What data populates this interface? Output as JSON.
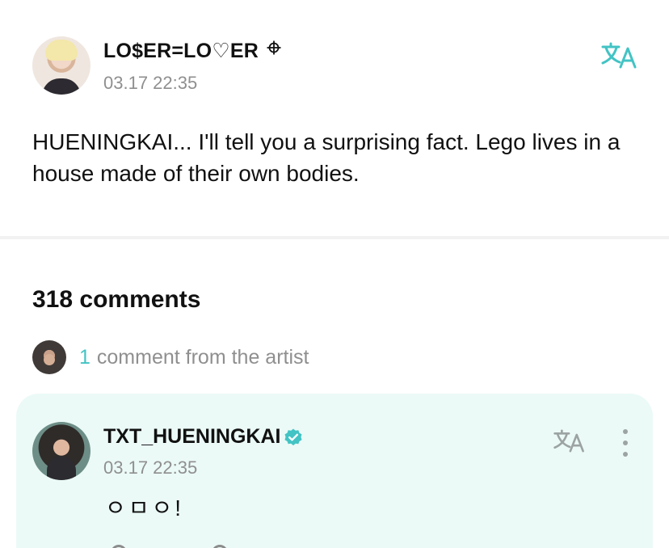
{
  "post": {
    "author_name": "LO$ER=LO♡ER",
    "time": "03.17 22:35",
    "body": "HUENINGKAI... I'll tell you a surprising fact. Lego lives in a house made of their own bodies.",
    "icons": {
      "translate": "translate-icon"
    }
  },
  "comments": {
    "count_label": "318 comments",
    "artist_count": "1",
    "artist_label": "comment from the artist",
    "artist_comment": {
      "name": "TXT_HUENINGKAI",
      "time": "03.17 22:35",
      "text": "ㅇㅁㅇ!",
      "icons": {
        "verified": "verified-icon",
        "translate": "translate-icon",
        "more": "more-vertical-icon"
      }
    }
  },
  "colors": {
    "accent": "#43C3C4",
    "card_background": "#EBFAF7",
    "secondary_text": "#8F8F8F"
  }
}
